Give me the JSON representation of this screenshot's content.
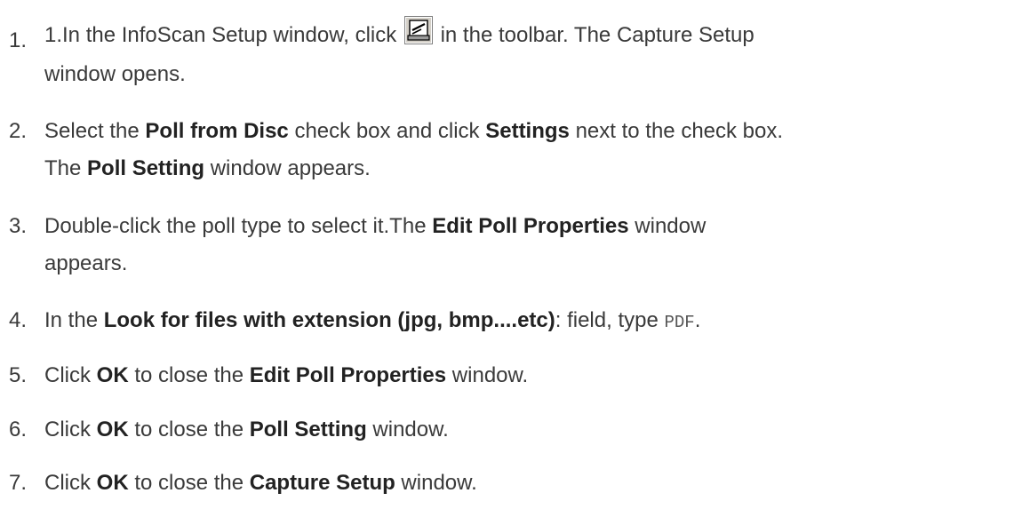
{
  "steps": [
    {
      "number": "1.",
      "line1_a": "1.In the InfoScan Setup window, click ",
      "icon": "scanner-toolbar-icon",
      "line1_b": " in the toolbar. The Capture Setup",
      "line2": "window opens."
    },
    {
      "number": "2.",
      "p1": "Select the ",
      "b1": "Poll from Disc",
      "p2": " check box and click ",
      "b2": "Settings",
      "p3": " next to the check box.",
      "p4": "The ",
      "b3": "Poll Setting",
      "p5": " window appears."
    },
    {
      "number": "3.",
      "p1": "Double-click the poll type to select it.The ",
      "b1": "Edit Poll Properties",
      "p2": " window",
      "line2": "appears."
    },
    {
      "number": "4.",
      "p1": "In the ",
      "b1": "Look for files with extension (jpg, bmp....etc)",
      "p2": ": field, type ",
      "code": "PDF",
      "p3": "."
    },
    {
      "number": "5.",
      "p1": "Click ",
      "b1": "OK",
      "p2": " to close the ",
      "b2": "Edit Poll Properties",
      "p3": " window."
    },
    {
      "number": "6.",
      "p1": "Click ",
      "b1": "OK",
      "p2": " to close the ",
      "b2": "Poll Setting",
      "p3": " window."
    },
    {
      "number": "7.",
      "p1": "Click ",
      "b1": "OK",
      "p2": " to close the ",
      "b2": "Capture Setup",
      "p3": " window."
    }
  ]
}
